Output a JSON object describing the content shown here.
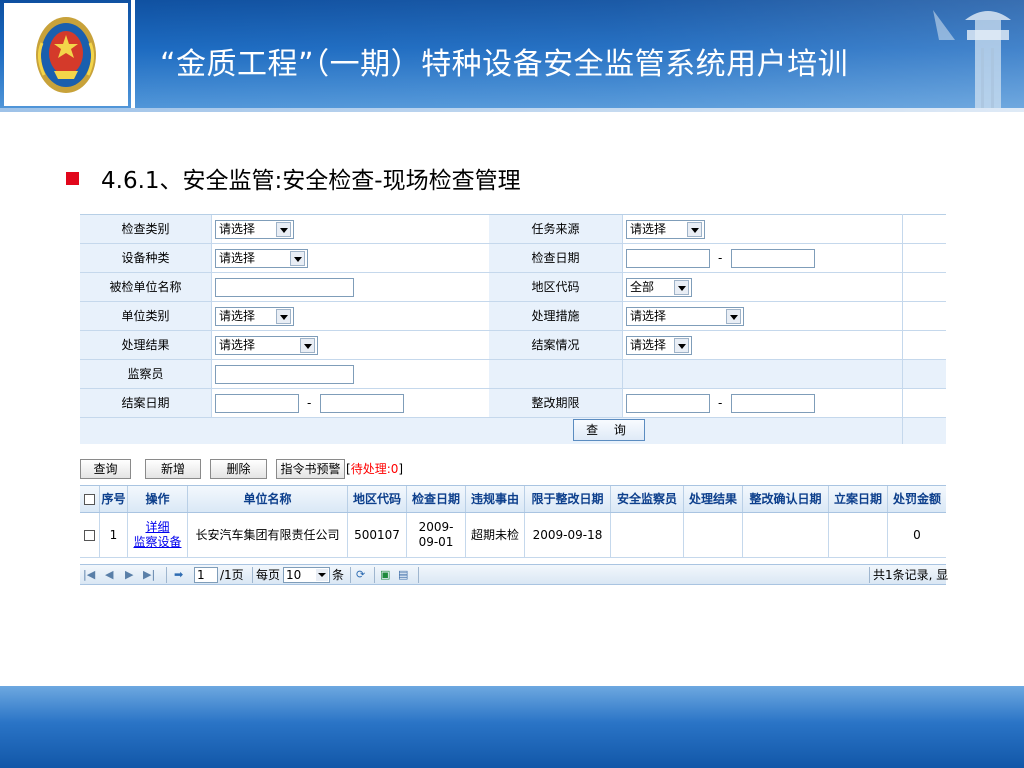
{
  "slide": {
    "title": "“金质工程”（一期）特种设备安全监管系统用户培训",
    "heading": "4.6.1、安全监管:安全检查-现场检查管理"
  },
  "colors": {
    "banner": "#1a69c0",
    "bullet": "#e1061b",
    "footer": "#2a74c6",
    "pending": "#ff0000"
  },
  "form": {
    "rows": [
      {
        "left_label": "检查类别",
        "left_value": "请选择",
        "right_label": "任务来源",
        "right_value": "请选择"
      },
      {
        "left_label": "设备种类",
        "left_value": "请选择",
        "right_label": "检查日期",
        "right_value": ""
      },
      {
        "left_label": "被检单位名称",
        "left_value": "",
        "right_label": "地区代码",
        "right_value": "全部"
      },
      {
        "left_label": "单位类别",
        "left_value": "请选择",
        "right_label": "处理措施",
        "right_value": "请选择"
      },
      {
        "left_label": "处理结果",
        "left_value": "请选择",
        "right_label": "结案情况",
        "right_value": "请选择"
      },
      {
        "left_label": "监察员",
        "left_value": "",
        "right_label": "",
        "right_value": ""
      },
      {
        "left_label": "结案日期",
        "left_value": "",
        "right_label": "整改期限",
        "right_value": ""
      }
    ],
    "range_separator": "-",
    "search_label": "查 询"
  },
  "toolbar": {
    "query_label": "查询",
    "add_label": "新增",
    "delete_label": "删除",
    "warn_label": "指令书预警",
    "pending_open": "[",
    "pending_text": "待处理:0",
    "pending_close": "]"
  },
  "grid": {
    "columns": [
      "序号",
      "操作",
      "单位名称",
      "地区代码",
      "检查日期",
      "违规事由",
      "限于整改日期",
      "安全监察员",
      "处理结果",
      "整改确认日期",
      "立案日期",
      "处罚金额"
    ],
    "rows": [
      {
        "index": "1",
        "action_detail": "详细",
        "action_inspect": "监察设备",
        "unit_name": "长安汽车集团有限责任公司",
        "area_code": "500107",
        "check_date": "2009-09-01",
        "violation": "超期未检",
        "rectify_deadline": "2009-09-18",
        "inspector": "",
        "result": "",
        "confirm_date": "",
        "filing_date": "",
        "penalty": "0"
      }
    ]
  },
  "pager": {
    "page_value": "1",
    "page_total": "/1页",
    "per_page_label": "每页",
    "per_page_value": "10",
    "per_page_unit": "条",
    "summary": "共1条记录, 显"
  }
}
